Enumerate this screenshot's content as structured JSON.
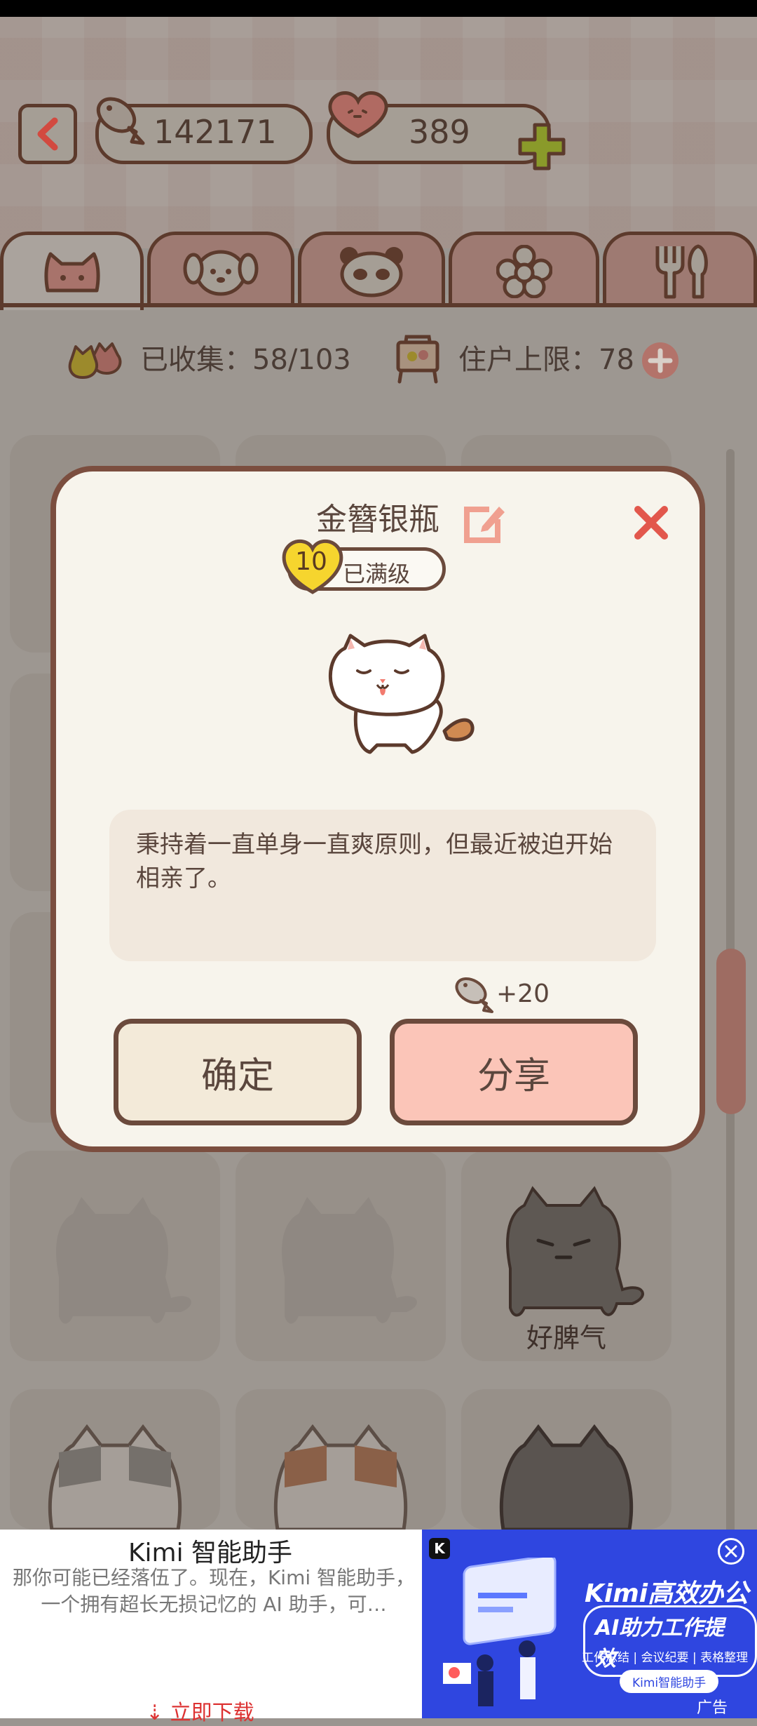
{
  "topbar": {
    "fish_count": "142171",
    "heart_count": "389",
    "back_icon": "chevron-left-icon",
    "add_icon": "plus-icon"
  },
  "tabs": [
    {
      "icon": "cat-face-icon",
      "active": true
    },
    {
      "icon": "dog-face-icon",
      "active": false
    },
    {
      "icon": "panda-face-icon",
      "active": false
    },
    {
      "icon": "flower-icon",
      "active": false
    },
    {
      "icon": "fork-spoon-icon",
      "active": false
    }
  ],
  "stats": {
    "collected": "已收集：58/103",
    "capacity": "住户上限：78"
  },
  "grid": {
    "visible_label": "好脾气"
  },
  "dialog": {
    "title": "金簪银瓶",
    "level": "10",
    "level_status": "已满级",
    "description": "秉持着一直单身一直爽原则，但最近被迫开始相亲了。",
    "reward": "+20",
    "confirm_label": "确定",
    "share_label": "分享"
  },
  "ad": {
    "title": "Kimi 智能助手",
    "description": "那你可能已经落伍了。现在，Kimi 智能助手，一个拥有超长无损记忆的 AI 助手，可…",
    "download": "⇣ 立即下载",
    "headline": "Kimi高效办公",
    "subheadline": "AI助力工作提效",
    "tags": "工作总结 | 会议纪要 | 表格整理",
    "brand": "Kimi智能助手",
    "label": "广告",
    "logo": "K"
  },
  "colors": {
    "outline": "#5c3a2c",
    "accent_red": "#e2574c",
    "share_pink": "#fbc5b8",
    "dialog_bg": "#f7f4ec",
    "ad_blue": "#2f46e0"
  }
}
